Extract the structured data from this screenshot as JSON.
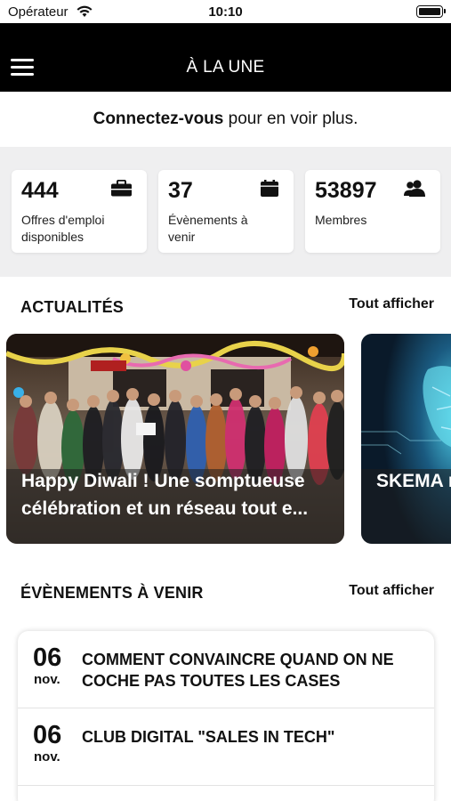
{
  "status_bar": {
    "carrier": "Opérateur",
    "time": "10:10"
  },
  "header": {
    "title": "À LA UNE"
  },
  "login_prompt": {
    "action": "Connectez-vous",
    "rest": " pour en voir plus."
  },
  "stats": [
    {
      "value": "444",
      "label": "Offres d'emploi disponibles",
      "icon": "briefcase-icon"
    },
    {
      "value": "37",
      "label": "Évènements à venir",
      "icon": "calendar-icon"
    },
    {
      "value": "53897",
      "label": "Membres",
      "icon": "members-icon"
    }
  ],
  "news": {
    "title": "ACTUALITÉS",
    "see_all": "Tout afficher",
    "items": [
      {
        "text": "Happy Diwali ! Une somptueuse célébration et un réseau tout e..."
      },
      {
        "text": "SKEMA recherc"
      }
    ]
  },
  "events": {
    "title": "ÉVÈNEMENTS À VENIR",
    "see_all": "Tout afficher",
    "items": [
      {
        "day": "06",
        "month": "nov.",
        "title": "COMMENT CONVAINCRE QUAND ON NE COCHE PAS TOUTES LES CASES"
      },
      {
        "day": "06",
        "month": "nov.",
        "title": "CLUB DIGITAL \"SALES IN TECH\""
      }
    ]
  }
}
